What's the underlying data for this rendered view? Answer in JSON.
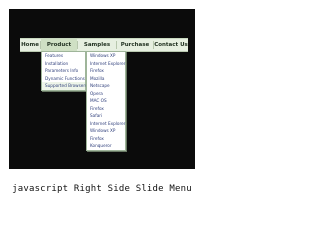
{
  "menu": {
    "items": [
      {
        "label": "Home"
      },
      {
        "label": "Product Info"
      },
      {
        "label": "Samples"
      },
      {
        "label": "Purchase"
      },
      {
        "label": "Contact Us"
      }
    ]
  },
  "dropdowns": {
    "product_info": [
      "Features",
      "Installation",
      "Parameters Info",
      "Dynamic Functions",
      "Supported Browsers"
    ],
    "samples": [
      "Windows XP",
      "Internet Explorer",
      "Firefox",
      "Mozilla",
      "Netscape",
      "Opera",
      "MAC OS",
      "Firefox",
      "Safari",
      "Internet Explorer",
      "Windows XP",
      "Firefox",
      "Konqueror"
    ]
  },
  "caption": "javascript Right Side Slide Menu"
}
